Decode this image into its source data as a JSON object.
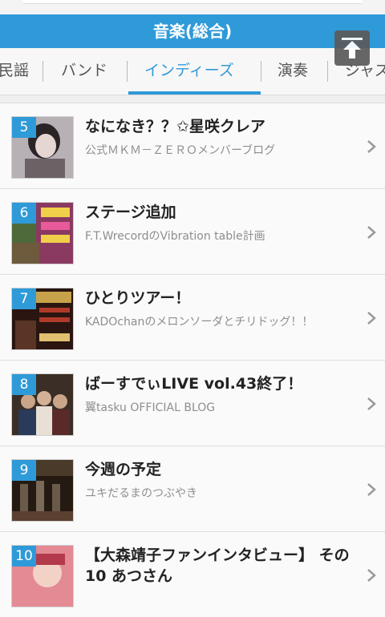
{
  "header": {
    "title": "音楽(総合)"
  },
  "tabs": [
    {
      "label": "民謡",
      "active": false
    },
    {
      "label": "バンド",
      "active": false
    },
    {
      "label": "インディーズ",
      "active": true
    },
    {
      "label": "演奏",
      "active": false
    },
    {
      "label": "ジャズ",
      "active": false
    }
  ],
  "items": [
    {
      "rank": "5",
      "title": "なになき？？✩星咲クレア",
      "subtitle": "公式ＭＫＭ－ＺＥＲＯメンバーブログ",
      "thumb_color": "#a9a2a6"
    },
    {
      "rank": "6",
      "title": "ステージ追加",
      "subtitle": "F.T.WrecordのVibration table計画",
      "thumb_color": "#7d3d5c"
    },
    {
      "rank": "7",
      "title": "ひとりツアー！",
      "subtitle": "KADOchanのメロンソーダとチリドッグ！！",
      "thumb_color": "#3a1f14"
    },
    {
      "rank": "8",
      "title": "ばーすでぃLIVE vol.43終了！",
      "subtitle": "翼tasku OFFICIAL BLOG",
      "thumb_color": "#4a3a2e"
    },
    {
      "rank": "9",
      "title": "今週の予定",
      "subtitle": "ユキだるまのつぶやき",
      "thumb_color": "#2e2219"
    },
    {
      "rank": "10",
      "title": "【大森靖子ファンインタビュー】 その10 あつさん",
      "subtitle": "",
      "thumb_color": "#d96a7a"
    }
  ]
}
